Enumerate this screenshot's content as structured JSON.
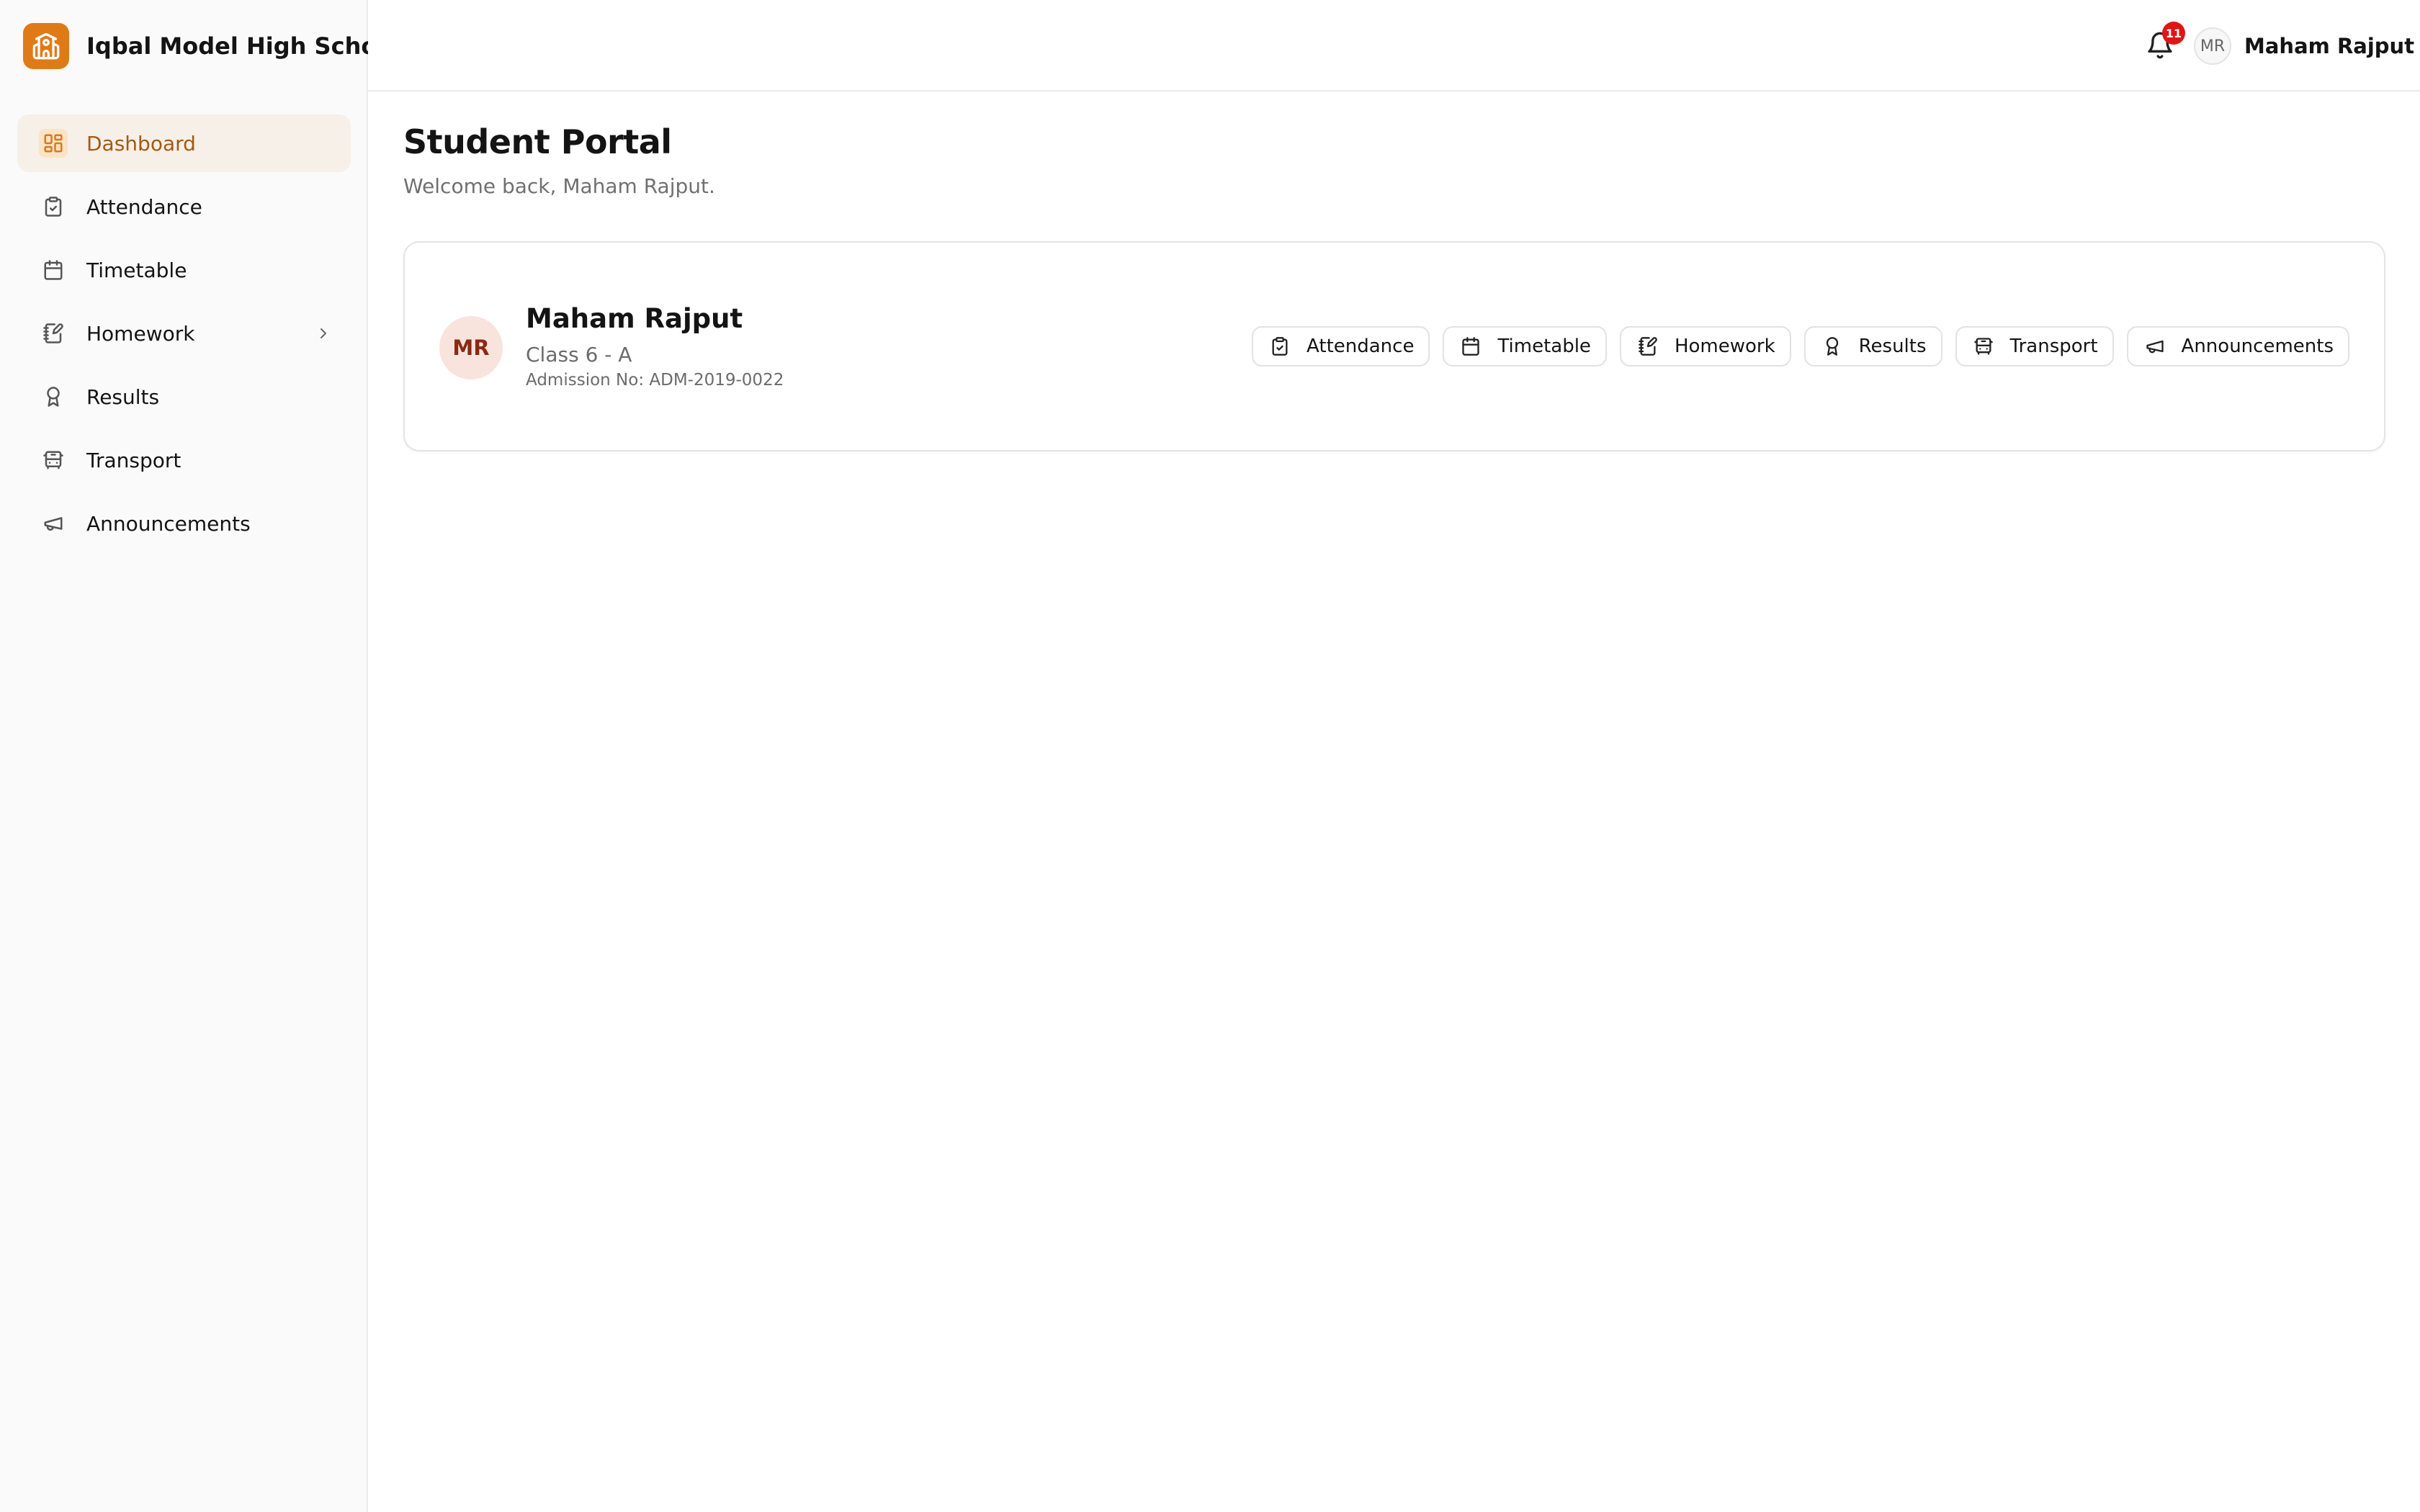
{
  "brand": {
    "name": "Iqbal Model High School",
    "logo_icon": "school-icon",
    "accent": "#e07a17"
  },
  "sidebar": {
    "items": [
      {
        "label": "Dashboard",
        "icon": "dashboard-icon",
        "active": true
      },
      {
        "label": "Attendance",
        "icon": "clipboard-check-icon"
      },
      {
        "label": "Timetable",
        "icon": "calendar-icon"
      },
      {
        "label": "Homework",
        "icon": "notebook-pen-icon",
        "has_submenu": true
      },
      {
        "label": "Results",
        "icon": "award-icon"
      },
      {
        "label": "Transport",
        "icon": "bus-icon"
      },
      {
        "label": "Announcements",
        "icon": "megaphone-icon"
      }
    ]
  },
  "header": {
    "notifications": {
      "icon": "bell-icon",
      "badge_count": "11"
    },
    "user": {
      "initials": "MR",
      "name": "Maham Rajput"
    }
  },
  "main": {
    "title": "Student Portal",
    "subtitle": "Welcome back, Maham Rajput.",
    "student": {
      "initials": "MR",
      "name": "Maham Rajput",
      "class": "Class 6 - A",
      "admission": "Admission No: ADM-2019-0022"
    },
    "quick_links": [
      {
        "label": "Attendance",
        "icon": "clipboard-check-icon"
      },
      {
        "label": "Timetable",
        "icon": "calendar-icon"
      },
      {
        "label": "Homework",
        "icon": "notebook-pen-icon"
      },
      {
        "label": "Results",
        "icon": "award-icon"
      },
      {
        "label": "Transport",
        "icon": "bus-icon"
      },
      {
        "label": "Announcements",
        "icon": "megaphone-icon"
      }
    ]
  }
}
